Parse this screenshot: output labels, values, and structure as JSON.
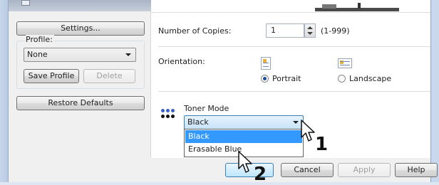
{
  "left": {
    "settings_label": "Settings...",
    "profile_label": "Profile:",
    "profile_value": "None",
    "save_profile_label": "Save Profile",
    "delete_label": "Delete",
    "restore_defaults_label": "Restore Defaults"
  },
  "copies": {
    "label": "Number of Copies:",
    "value": "1",
    "range": "(1-999)"
  },
  "orientation": {
    "label": "Orientation:",
    "options": [
      "Portrait",
      "Landscape"
    ],
    "selected": "Portrait"
  },
  "toner": {
    "label": "Toner Mode",
    "selected": "Black",
    "options": [
      "Black",
      "Erasable Blue"
    ],
    "highlighted": "Black"
  },
  "footer": {
    "cancel_label": "Cancel",
    "apply_label": "Apply",
    "help_label": "Help"
  },
  "annotations": {
    "step1": "1",
    "step2": "2"
  },
  "colors": {
    "selection": "#3399ff",
    "window_frame": "#c9d8ec"
  }
}
